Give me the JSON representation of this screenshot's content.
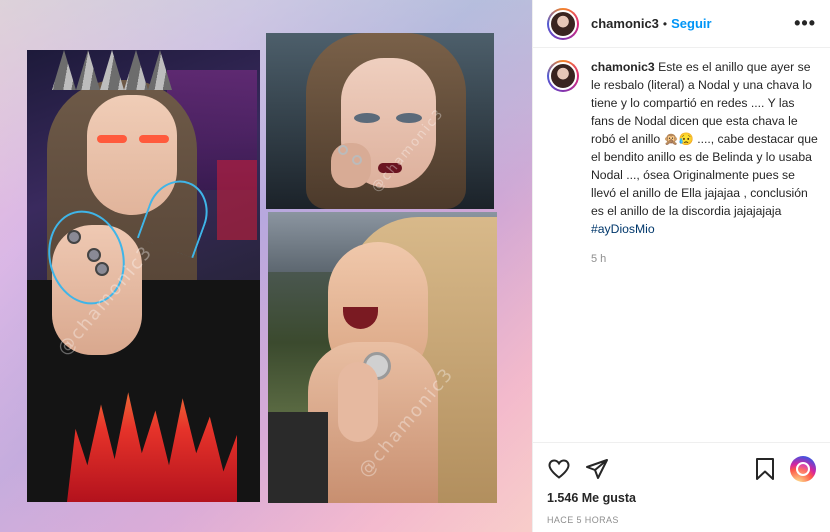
{
  "header": {
    "username": "chamonic3",
    "separator": "•",
    "follow_label": "Seguir",
    "more_icon": "more-options-icon"
  },
  "caption": {
    "username": "chamonic3",
    "text": "Este es el anillo que ayer se le resbalo (literal) a Nodal y una chava lo tiene y lo compartió en redes .... Y las fans de Nodal dicen que esta chava le robó el anillo 🙊😥 ...., cabe destacar que el bendito anillo es de Belinda y lo usaba Nodal ..., ósea Originalmente pues se llevó el anillo de Ella jajajaa , conclusión es el anillo de la discordia jajajajaja",
    "hashtag": "#ayDiosMio",
    "time": "5 h"
  },
  "actions": {
    "like_icon": "heart-icon",
    "share_icon": "share-icon",
    "save_icon": "bookmark-icon",
    "likes_text": "1.546 Me gusta",
    "posted_text": "HACE 5 HORAS"
  },
  "media": {
    "watermark": "@chamonic3"
  },
  "colors": {
    "accent": "#0095f6",
    "hashtag": "#00376b",
    "muted": "#8e8e8e"
  }
}
